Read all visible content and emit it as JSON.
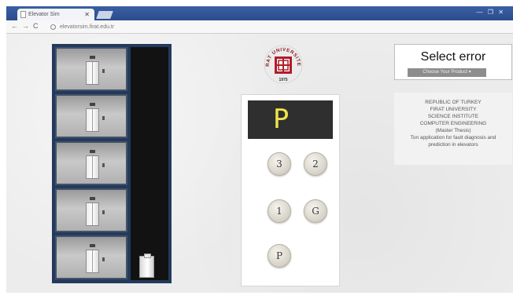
{
  "browser": {
    "tab_title": "Elevator Sim",
    "tab_close": "✕",
    "window_controls": "— ❐ ✕",
    "back": "←",
    "forward": "→",
    "reload": "C",
    "url": "elevatorsim.firat.edu.tr"
  },
  "building": {
    "floors": [
      "3",
      "2",
      "1",
      "G",
      "P"
    ]
  },
  "logo": {
    "text_top": "FIRAT UNIVERSITESI",
    "year": "1975",
    "colors": {
      "ring": "#8b1a1a",
      "emblem": "#b01e2a"
    }
  },
  "panel": {
    "display_value": "P",
    "display_color": "#f0e44a",
    "buttons": [
      {
        "label": "3"
      },
      {
        "label": "2"
      },
      {
        "label": "1"
      },
      {
        "label": "G"
      },
      {
        "label": "P"
      }
    ]
  },
  "select_error": {
    "title": "Select error",
    "dropdown_value": "Choose Your Product ▾"
  },
  "info": {
    "lines": [
      "REPUBLIC OF TURKEY",
      "FIRAT UNIVERSITY",
      "SCIENCE INSTITUTE",
      "COMPUTER ENGINEERING",
      "(Master Thesis)",
      "Ton application for fault diagnosis and",
      "prediction in elevators"
    ]
  }
}
